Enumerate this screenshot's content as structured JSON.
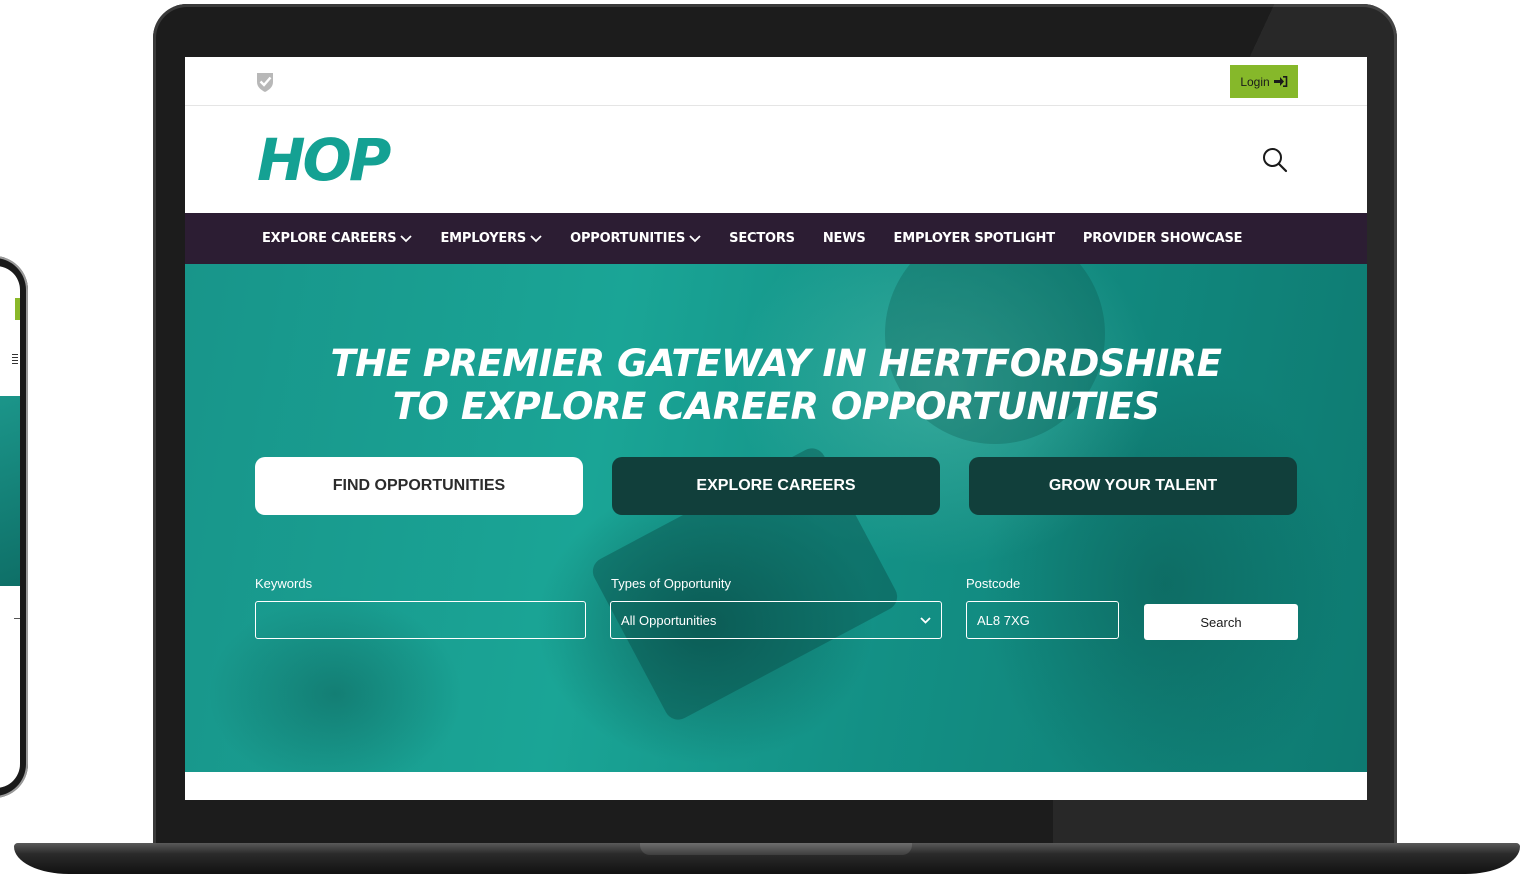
{
  "topbar": {
    "login_label": "Login"
  },
  "brand": {
    "logo_text": "HOP",
    "accent": "#14a193"
  },
  "nav": {
    "items": [
      {
        "label": "EXPLORE CAREERS",
        "has_dropdown": true
      },
      {
        "label": "EMPLOYERS",
        "has_dropdown": true
      },
      {
        "label": "OPPORTUNITIES",
        "has_dropdown": true
      },
      {
        "label": "SECTORS",
        "has_dropdown": false
      },
      {
        "label": "NEWS",
        "has_dropdown": false
      },
      {
        "label": "EMPLOYER SPOTLIGHT",
        "has_dropdown": false
      },
      {
        "label": "PROVIDER SHOWCASE",
        "has_dropdown": false
      }
    ],
    "background": "#2c1d33"
  },
  "hero": {
    "title_line1": "THE PREMIER GATEWAY IN HERTFORDSHIRE",
    "title_line2": "TO EXPLORE CAREER OPPORTUNITIES",
    "tabs": [
      {
        "label": "FIND OPPORTUNITIES",
        "active": true
      },
      {
        "label": "EXPLORE CAREERS",
        "active": false
      },
      {
        "label": "GROW YOUR TALENT",
        "active": false
      }
    ],
    "search": {
      "keywords_label": "Keywords",
      "keywords_value": "",
      "type_label": "Types of Opportunity",
      "type_value": "All Opportunities",
      "postcode_label": "Postcode",
      "postcode_value": "AL8 7XG",
      "button_label": "Search"
    }
  },
  "colors": {
    "login_green": "#86b82a",
    "hero_teal": "#1aa596"
  }
}
